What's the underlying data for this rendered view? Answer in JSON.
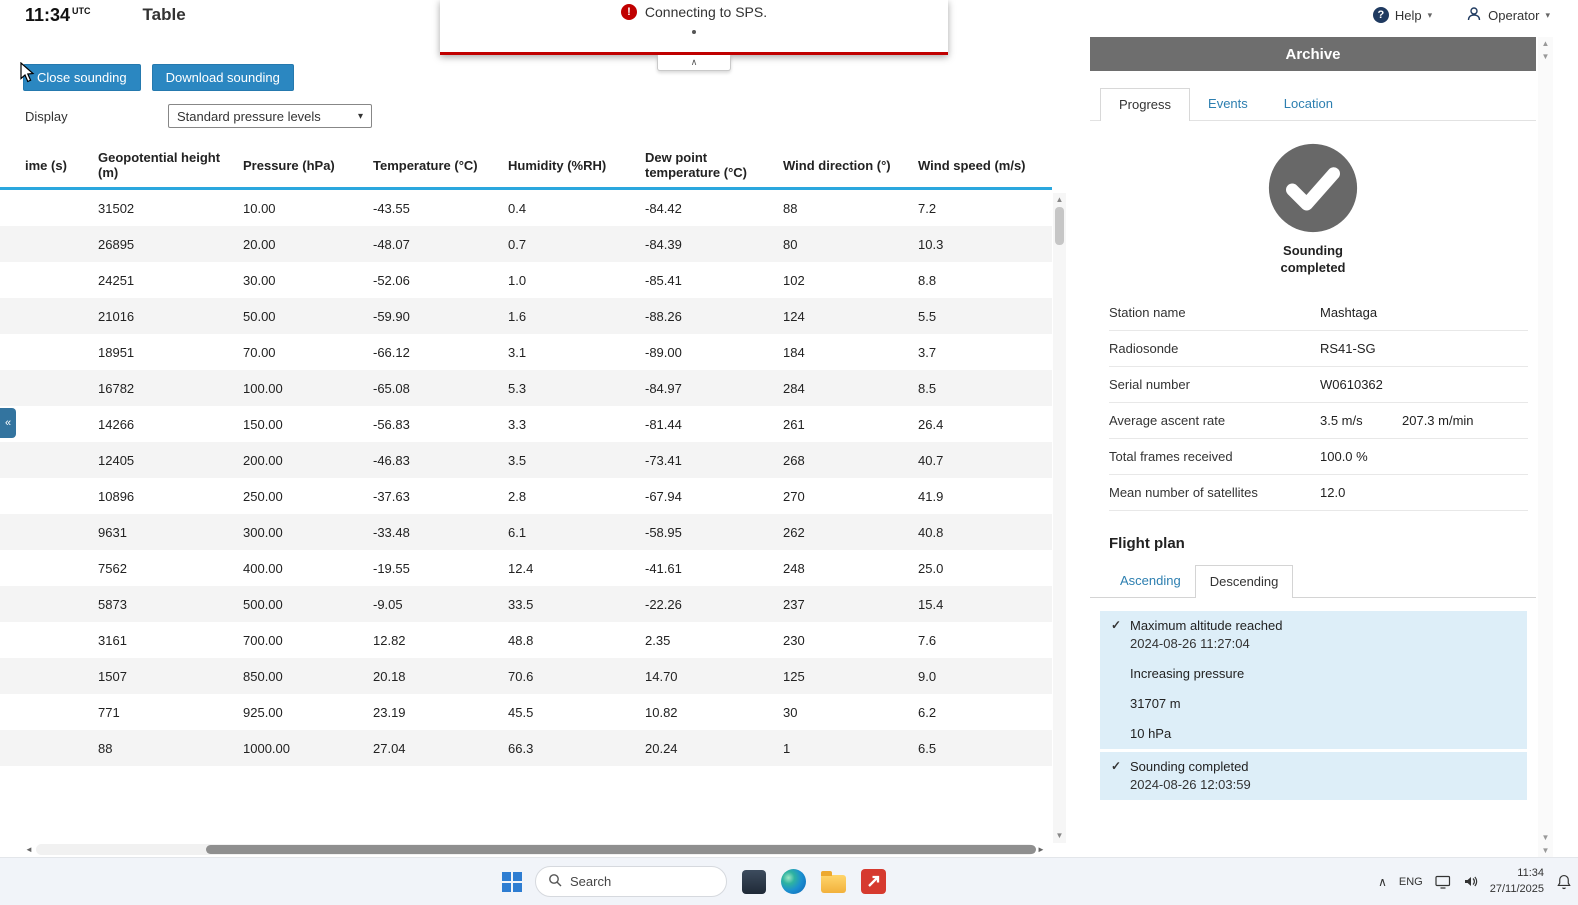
{
  "colors": {
    "accent": "#2b87c1",
    "error": "#c00000",
    "link": "#2d7fb0",
    "highlight": "#ddeef8",
    "panel_header": "#6e6e6e",
    "table_accent": "#2aa7de",
    "row_alt": "#f4f4f4",
    "taskbar_bg": "#f1f4f9"
  },
  "topbar": {
    "time": "11:34",
    "time_zone": "UTC",
    "title": "Table",
    "help": "Help",
    "operator": "Operator"
  },
  "notification": {
    "message": "Connecting to SPS."
  },
  "toolbar": {
    "close": "Close sounding",
    "download": "Download sounding",
    "display_label": "Display",
    "display_value": "Standard pressure levels"
  },
  "table": {
    "columns": [
      "ime (s)",
      "Geopotential height (m)",
      "Pressure (hPa)",
      "Temperature (°C)",
      "Humidity (%RH)",
      "Dew point temperature (°C)",
      "Wind direction (°)",
      "Wind speed (m/s)"
    ],
    "rows": [
      {
        "t": "",
        "h": "31502",
        "p": "10.00",
        "temp": "-43.55",
        "rh": "0.4",
        "dp": "-84.42",
        "wd": "88",
        "ws": "7.2"
      },
      {
        "t": "",
        "h": "26895",
        "p": "20.00",
        "temp": "-48.07",
        "rh": "0.7",
        "dp": "-84.39",
        "wd": "80",
        "ws": "10.3"
      },
      {
        "t": "",
        "h": "24251",
        "p": "30.00",
        "temp": "-52.06",
        "rh": "1.0",
        "dp": "-85.41",
        "wd": "102",
        "ws": "8.8"
      },
      {
        "t": "",
        "h": "21016",
        "p": "50.00",
        "temp": "-59.90",
        "rh": "1.6",
        "dp": "-88.26",
        "wd": "124",
        "ws": "5.5"
      },
      {
        "t": "",
        "h": "18951",
        "p": "70.00",
        "temp": "-66.12",
        "rh": "3.1",
        "dp": "-89.00",
        "wd": "184",
        "ws": "3.7"
      },
      {
        "t": "",
        "h": "16782",
        "p": "100.00",
        "temp": "-65.08",
        "rh": "5.3",
        "dp": "-84.97",
        "wd": "284",
        "ws": "8.5"
      },
      {
        "t": "",
        "h": "14266",
        "p": "150.00",
        "temp": "-56.83",
        "rh": "3.3",
        "dp": "-81.44",
        "wd": "261",
        "ws": "26.4"
      },
      {
        "t": "",
        "h": "12405",
        "p": "200.00",
        "temp": "-46.83",
        "rh": "3.5",
        "dp": "-73.41",
        "wd": "268",
        "ws": "40.7"
      },
      {
        "t": "",
        "h": "10896",
        "p": "250.00",
        "temp": "-37.63",
        "rh": "2.8",
        "dp": "-67.94",
        "wd": "270",
        "ws": "41.9"
      },
      {
        "t": "",
        "h": "9631",
        "p": "300.00",
        "temp": "-33.48",
        "rh": "6.1",
        "dp": "-58.95",
        "wd": "262",
        "ws": "40.8"
      },
      {
        "t": "",
        "h": "7562",
        "p": "400.00",
        "temp": "-19.55",
        "rh": "12.4",
        "dp": "-41.61",
        "wd": "248",
        "ws": "25.0"
      },
      {
        "t": "",
        "h": "5873",
        "p": "500.00",
        "temp": "-9.05",
        "rh": "33.5",
        "dp": "-22.26",
        "wd": "237",
        "ws": "15.4"
      },
      {
        "t": "",
        "h": "3161",
        "p": "700.00",
        "temp": "12.82",
        "rh": "48.8",
        "dp": "2.35",
        "wd": "230",
        "ws": "7.6"
      },
      {
        "t": "",
        "h": "1507",
        "p": "850.00",
        "temp": "20.18",
        "rh": "70.6",
        "dp": "14.70",
        "wd": "125",
        "ws": "9.0"
      },
      {
        "t": "",
        "h": "771",
        "p": "925.00",
        "temp": "23.19",
        "rh": "45.5",
        "dp": "10.82",
        "wd": "30",
        "ws": "6.2"
      },
      {
        "t": "",
        "h": "88",
        "p": "1000.00",
        "temp": "27.04",
        "rh": "66.3",
        "dp": "20.24",
        "wd": "1",
        "ws": "6.5"
      }
    ]
  },
  "archive": {
    "title": "Archive",
    "tabs": {
      "progress": "Progress",
      "events": "Events",
      "location": "Location"
    },
    "status": "Sounding completed",
    "details": [
      {
        "label": "Station name",
        "value": "Mashtaga"
      },
      {
        "label": "Radiosonde",
        "value": "RS41-SG"
      },
      {
        "label": "Serial number",
        "value": "W0610362"
      },
      {
        "label": "Average ascent rate",
        "value": "3.5 m/s",
        "extra": "207.3 m/min"
      },
      {
        "label": "Total frames received",
        "value": "100.0 %"
      },
      {
        "label": "Mean number of satellites",
        "value": "12.0"
      }
    ],
    "flight_plan": {
      "title": "Flight plan",
      "tab_ascending": "Ascending",
      "tab_descending": "Descending",
      "events": [
        {
          "title": "Maximum altitude reached",
          "time": "2024-08-26 11:27:04",
          "checked": true
        },
        {
          "title": "Increasing pressure",
          "checked": false
        },
        {
          "title": "31707 m",
          "checked": false
        },
        {
          "title": "10 hPa",
          "checked": false
        },
        {
          "title": "Sounding completed",
          "time": "2024-08-26 12:03:59",
          "checked": true
        }
      ]
    }
  },
  "taskbar": {
    "search": "Search",
    "tray_lang": "ENG",
    "tray_time": "11:34",
    "tray_date": "27/11/2025"
  }
}
